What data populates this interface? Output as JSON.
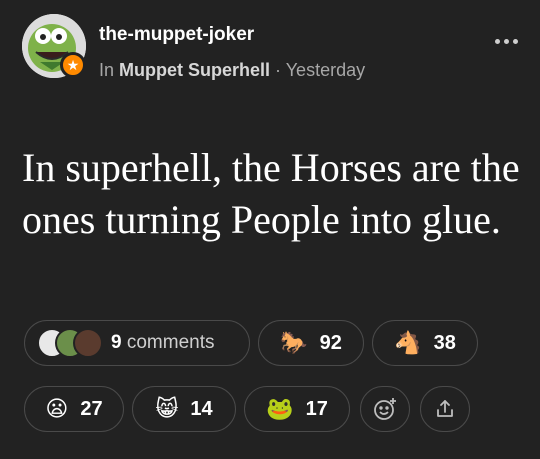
{
  "post": {
    "author": "the-muppet-joker",
    "meta_prefix": "In ",
    "community": "Muppet Superhell",
    "separator": " · ",
    "time": "Yesterday",
    "text": "In superhell, the Horses are the ones turning People into glue."
  },
  "comments": {
    "count": "9",
    "label": " comments"
  },
  "reactions": [
    {
      "icon": "horse-icon",
      "emoji": "🐎",
      "count": "92"
    },
    {
      "icon": "horse-face-icon",
      "emoji": "🐴",
      "count": "38"
    },
    {
      "icon": "frowning-face-icon",
      "emoji": "😦",
      "count": "27"
    },
    {
      "icon": "grinning-cat-icon",
      "emoji": "😸",
      "count": "14"
    },
    {
      "icon": "frog-icon",
      "emoji": "🐸",
      "count": "17"
    }
  ],
  "actions": {
    "add_reaction_icon": "add-emoji-icon",
    "share_icon": "share-icon"
  },
  "colors": {
    "background": "#222222",
    "badge": "#ff8a00",
    "border": "#4a4a4a",
    "muted": "#a7a7a7"
  }
}
